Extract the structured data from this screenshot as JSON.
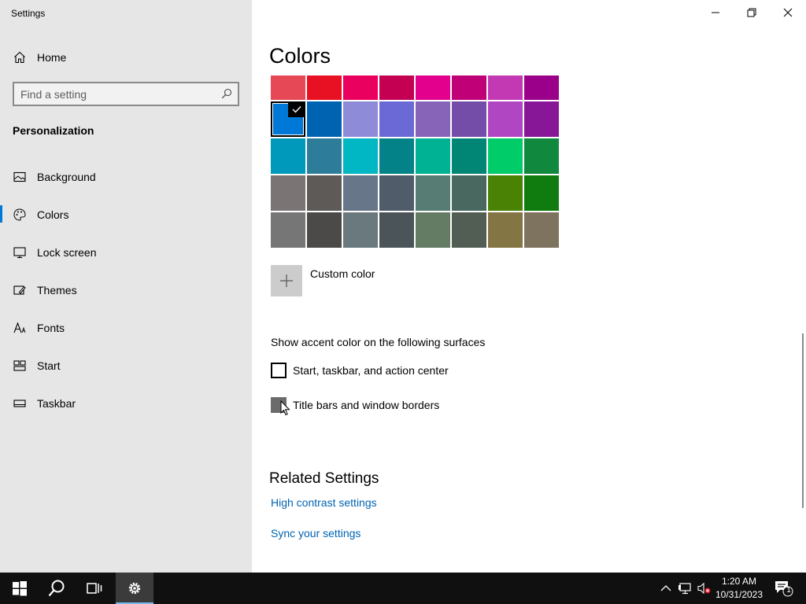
{
  "window": {
    "title": "Settings"
  },
  "sidebar": {
    "home_label": "Home",
    "search_placeholder": "Find a setting",
    "section": "Personalization",
    "items": [
      {
        "label": "Background",
        "icon": "picture-icon",
        "selected": false
      },
      {
        "label": "Colors",
        "icon": "palette-icon",
        "selected": true
      },
      {
        "label": "Lock screen",
        "icon": "lock-screen-icon",
        "selected": false
      },
      {
        "label": "Themes",
        "icon": "themes-icon",
        "selected": false
      },
      {
        "label": "Fonts",
        "icon": "fonts-icon",
        "selected": false
      },
      {
        "label": "Start",
        "icon": "start-icon",
        "selected": false
      },
      {
        "label": "Taskbar",
        "icon": "taskbar-icon",
        "selected": false
      }
    ]
  },
  "main": {
    "title": "Colors",
    "palette": [
      [
        "#e74856",
        "#e81123",
        "#ea005e",
        "#c30052",
        "#e3008c",
        "#bf0077",
        "#c239b3",
        "#9a0089"
      ],
      [
        "#0078d7",
        "#0063b1",
        "#8e8cd8",
        "#6b69d6",
        "#8764b8",
        "#744da9",
        "#b146c2",
        "#881798"
      ],
      [
        "#0099bc",
        "#2d7d9a",
        "#00b7c3",
        "#038387",
        "#00b294",
        "#018574",
        "#00cc6a",
        "#10893e"
      ],
      [
        "#7a7574",
        "#5d5a58",
        "#68768a",
        "#515c6b",
        "#567c73",
        "#486860",
        "#498205",
        "#107c10"
      ],
      [
        "#767676",
        "#4c4a48",
        "#69797e",
        "#4a5459",
        "#647c64",
        "#525e54",
        "#847545",
        "#7e735f"
      ]
    ],
    "selected_color": "#0078d7",
    "custom_color_label": "Custom color",
    "surfaces_title": "Show accent color on the following surfaces",
    "surface_options": [
      {
        "label": "Start, taskbar, and action center",
        "checked": false
      },
      {
        "label": "Title bars and window borders",
        "checked": false
      }
    ],
    "related_title": "Related Settings",
    "links": [
      "High contrast settings",
      "Sync your settings"
    ]
  },
  "taskbar": {
    "time": "1:20 AM",
    "date": "10/31/2023",
    "notification_count": "1"
  }
}
